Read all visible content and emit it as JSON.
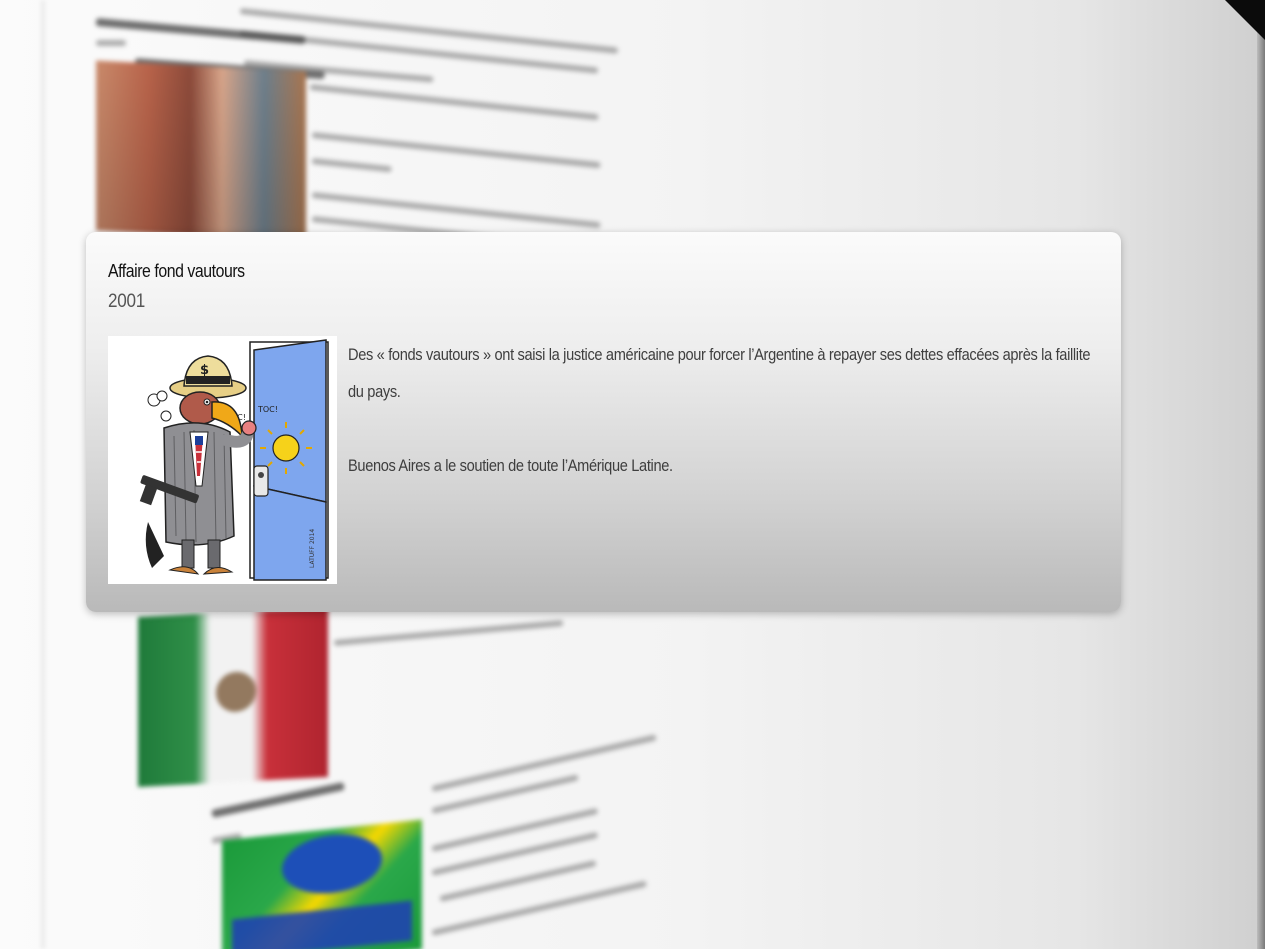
{
  "card": {
    "title": "Affaire fond vautours",
    "year": "2001",
    "image_icon": "vulture-cartoon-image",
    "cartoon_texts": [
      "TOC!",
      "TOC!"
    ],
    "paragraph_1": "Des « fonds vautours » ont saisi la justice américaine pour forcer l’Argentine à repayer ses dettes effacées après la faillite du pays.",
    "paragraph_2": "Buenos Aires a le soutien de toute l’Amérique Latine."
  },
  "colors": {
    "card_top": "#fbfbfb",
    "card_bottom": "#b9b9b9",
    "title": "#121212",
    "body_text": "#3e3e3e",
    "door_blue": "#7ea6ee",
    "sun_yellow": "#f6d21a"
  }
}
